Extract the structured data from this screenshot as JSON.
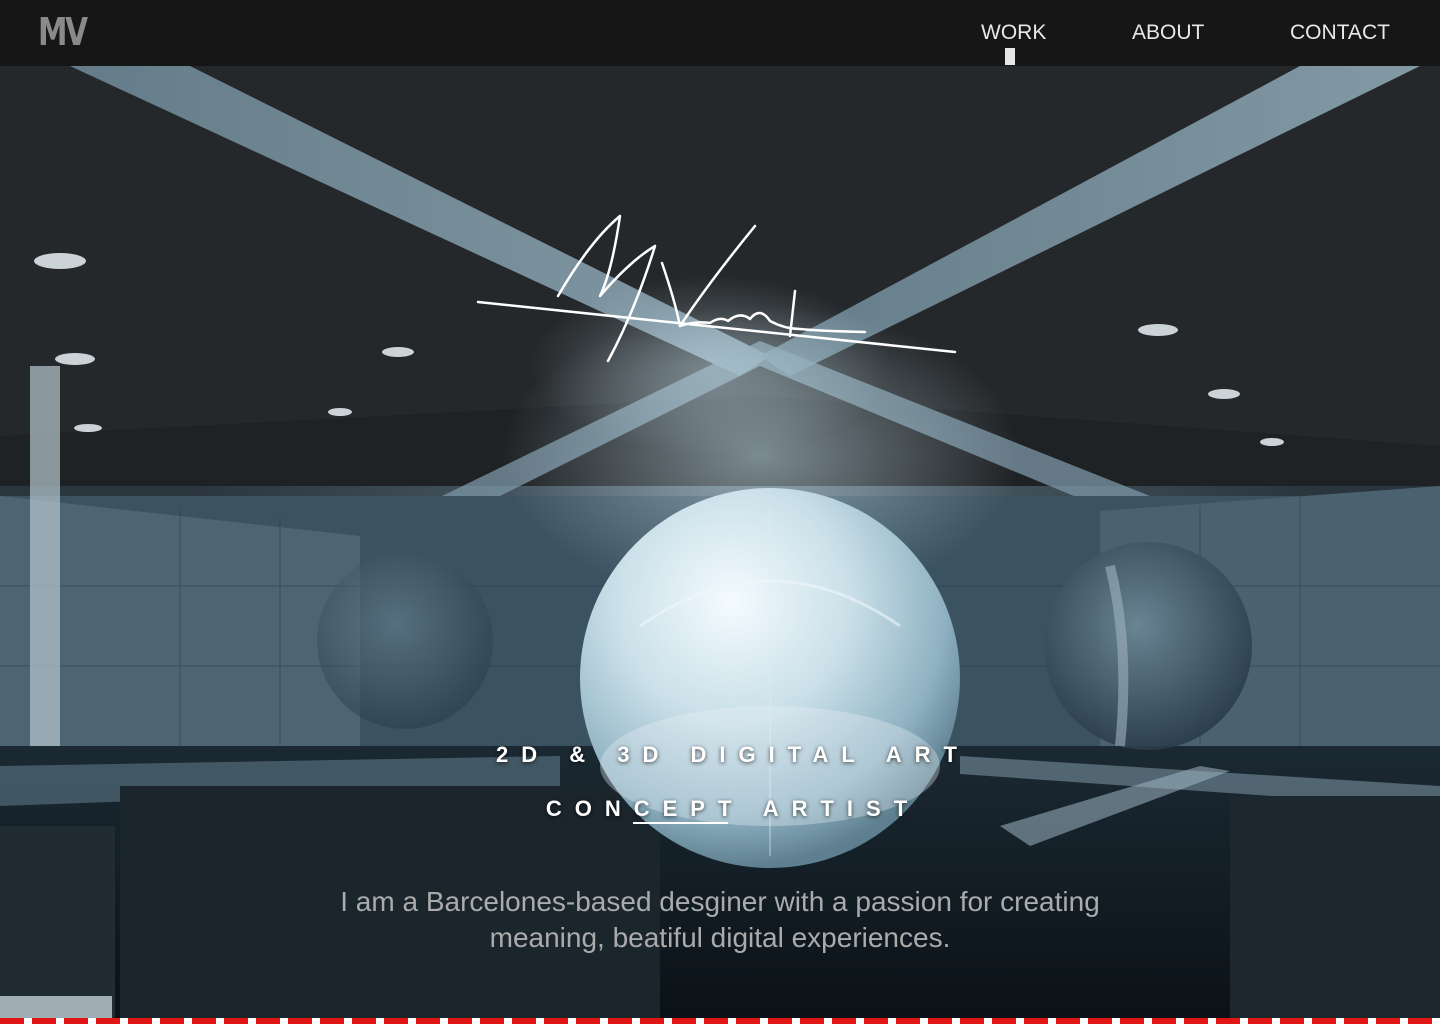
{
  "header": {
    "logo": "MV",
    "nav": [
      {
        "label": "WORK",
        "active": true
      },
      {
        "label": "ABOUT",
        "active": false
      },
      {
        "label": "CONTACT",
        "active": false
      }
    ]
  },
  "hero": {
    "tagline_1": "2D & 3D DIGITAL ART",
    "tagline_2": "CONCEPT ARTIST",
    "intro_line_1": "I am a Barcelones-based desginer with a passion for creating",
    "intro_line_2": "meaning, beatiful digital experiences."
  },
  "colors": {
    "header_bg": "#161616",
    "accent_strip": "#e01515",
    "nav_text": "#e8e8e8",
    "logo": "#8a8a8a"
  }
}
